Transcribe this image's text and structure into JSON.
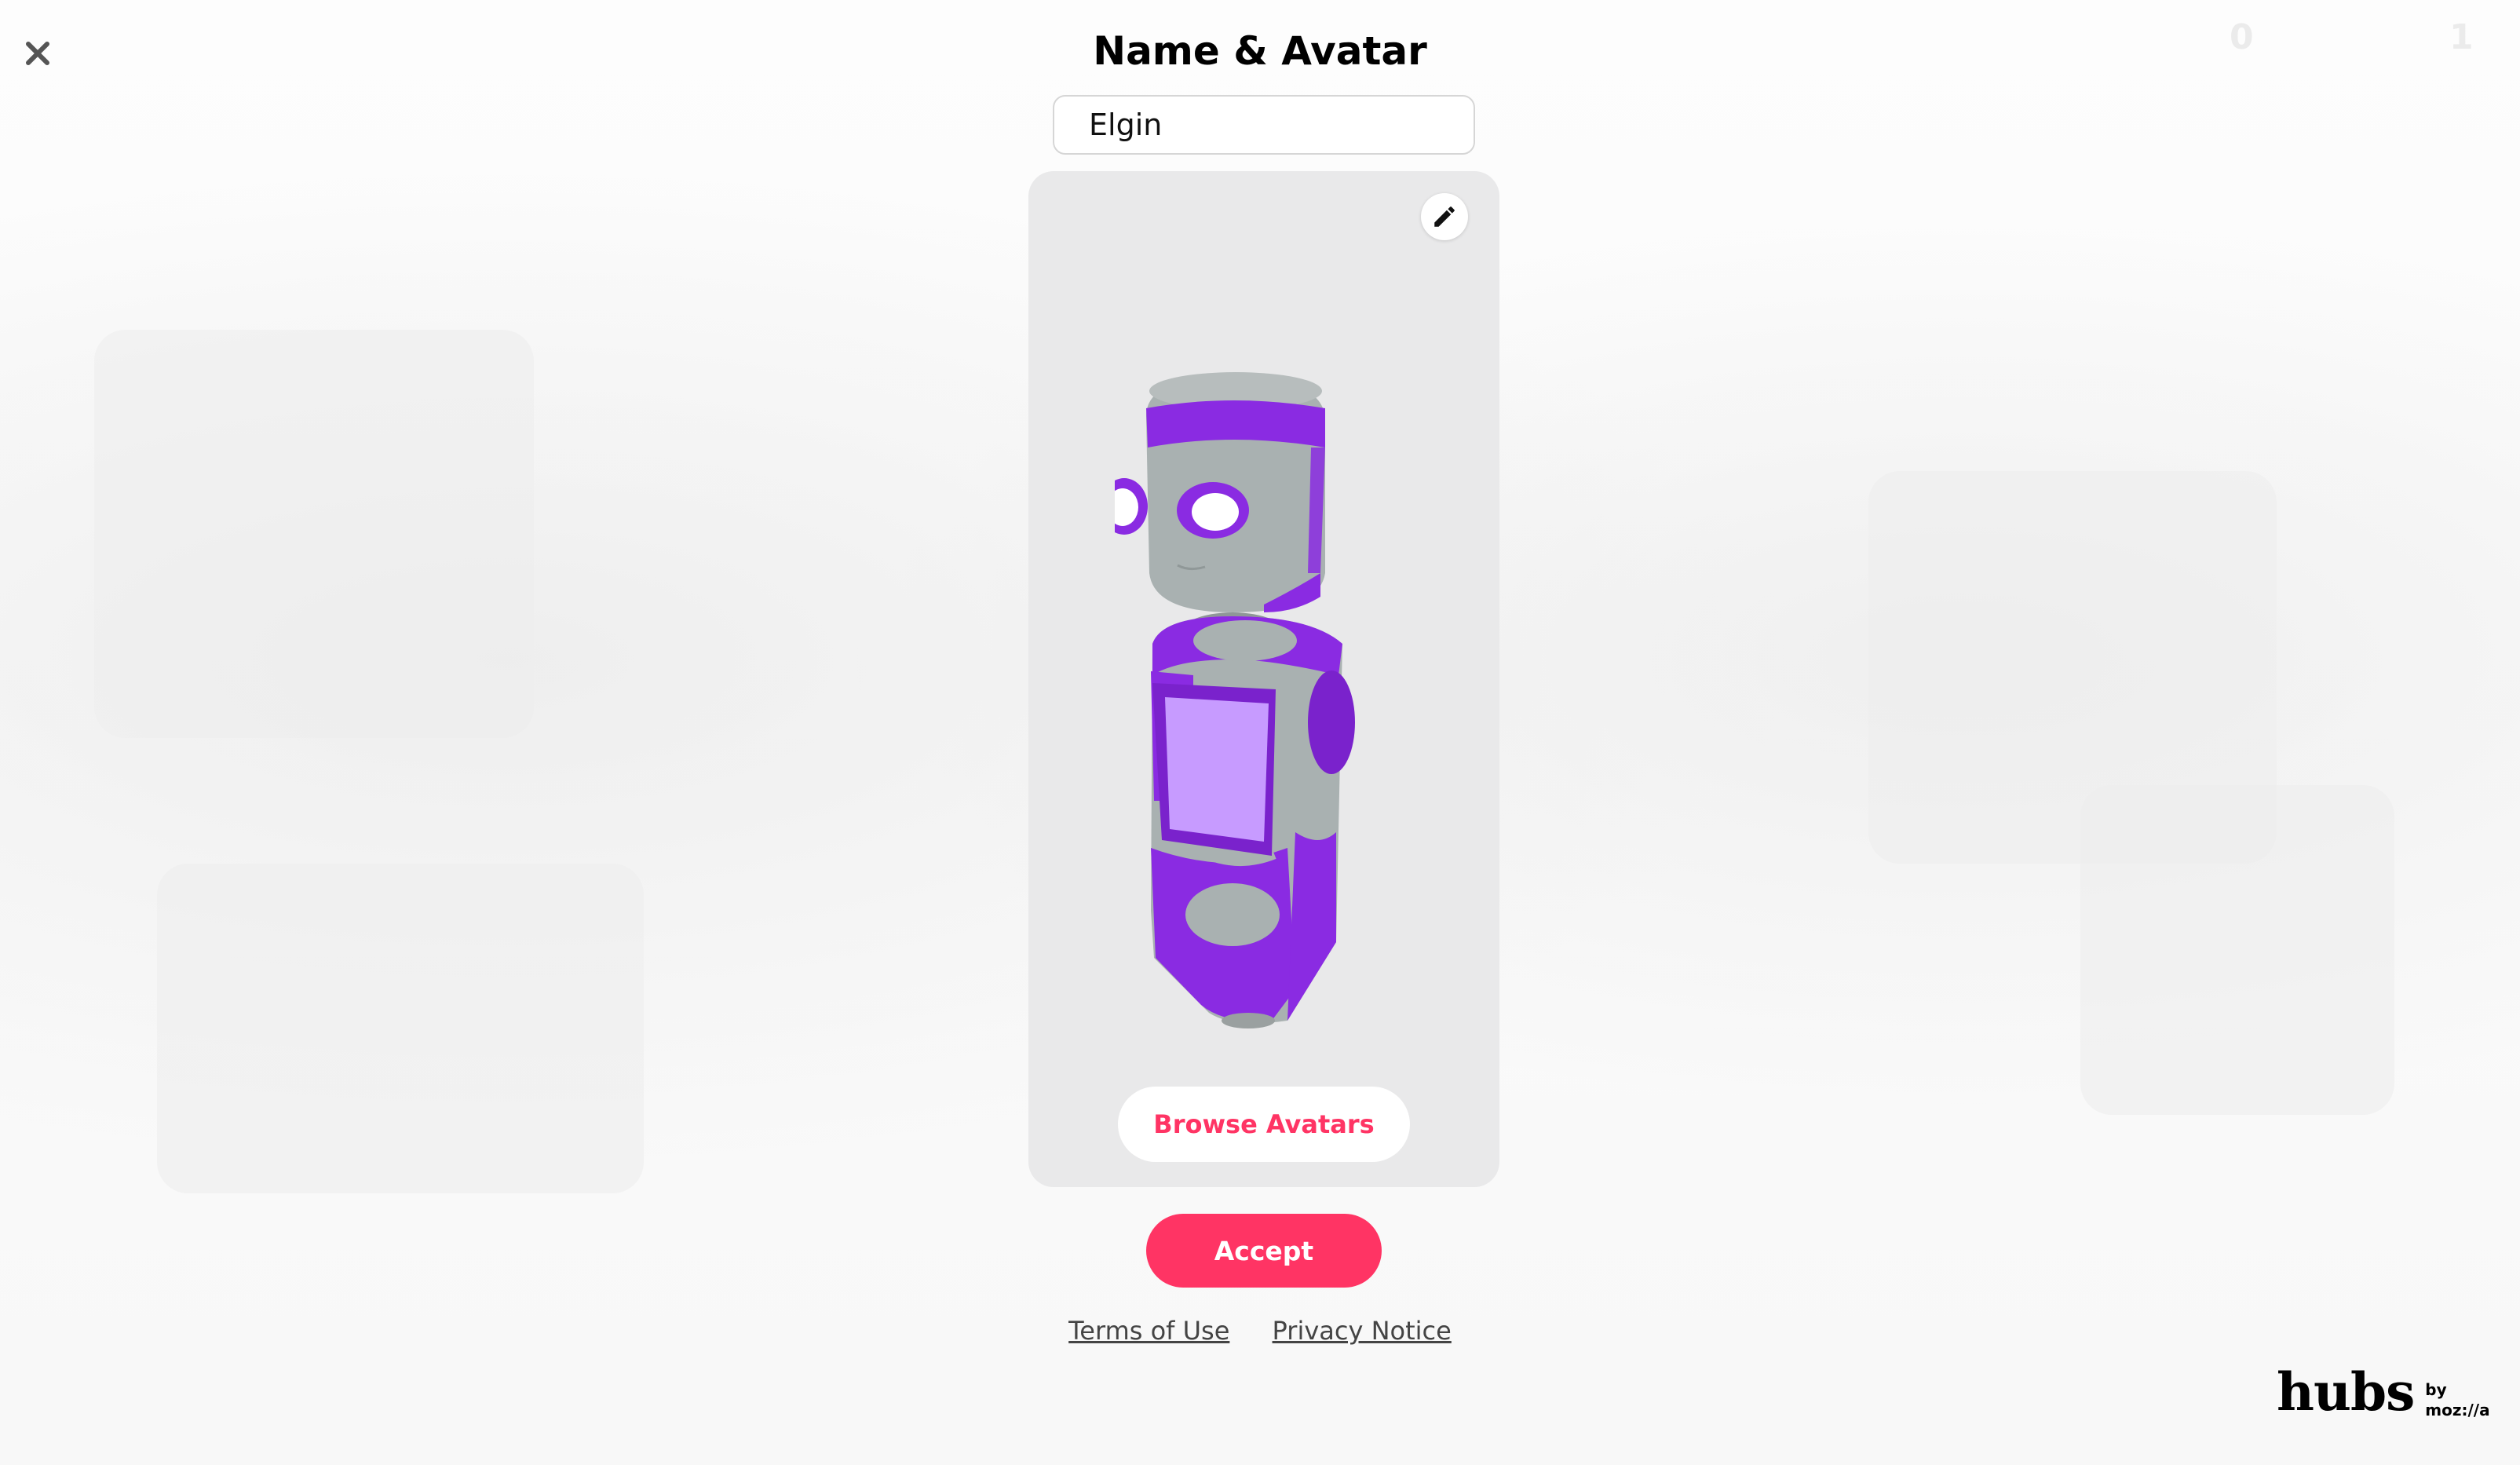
{
  "dialog": {
    "title": "Name & Avatar",
    "name_value": "Elgin",
    "browse_label": "Browse Avatars",
    "accept_label": "Accept"
  },
  "footer": {
    "terms_label": "Terms of Use",
    "privacy_label": "Privacy Notice"
  },
  "brand": {
    "name": "hubs",
    "by": "by",
    "org": "moz://a"
  },
  "hud": {
    "left_count": "0",
    "right_count": "1"
  },
  "colors": {
    "accent": "#ff3464",
    "avatar_purple": "#8a2be2",
    "avatar_gray": "#a9b1b1",
    "panel_bg": "#e9e9ea"
  },
  "icons": {
    "close": "close-icon",
    "edit": "pencil-icon"
  }
}
